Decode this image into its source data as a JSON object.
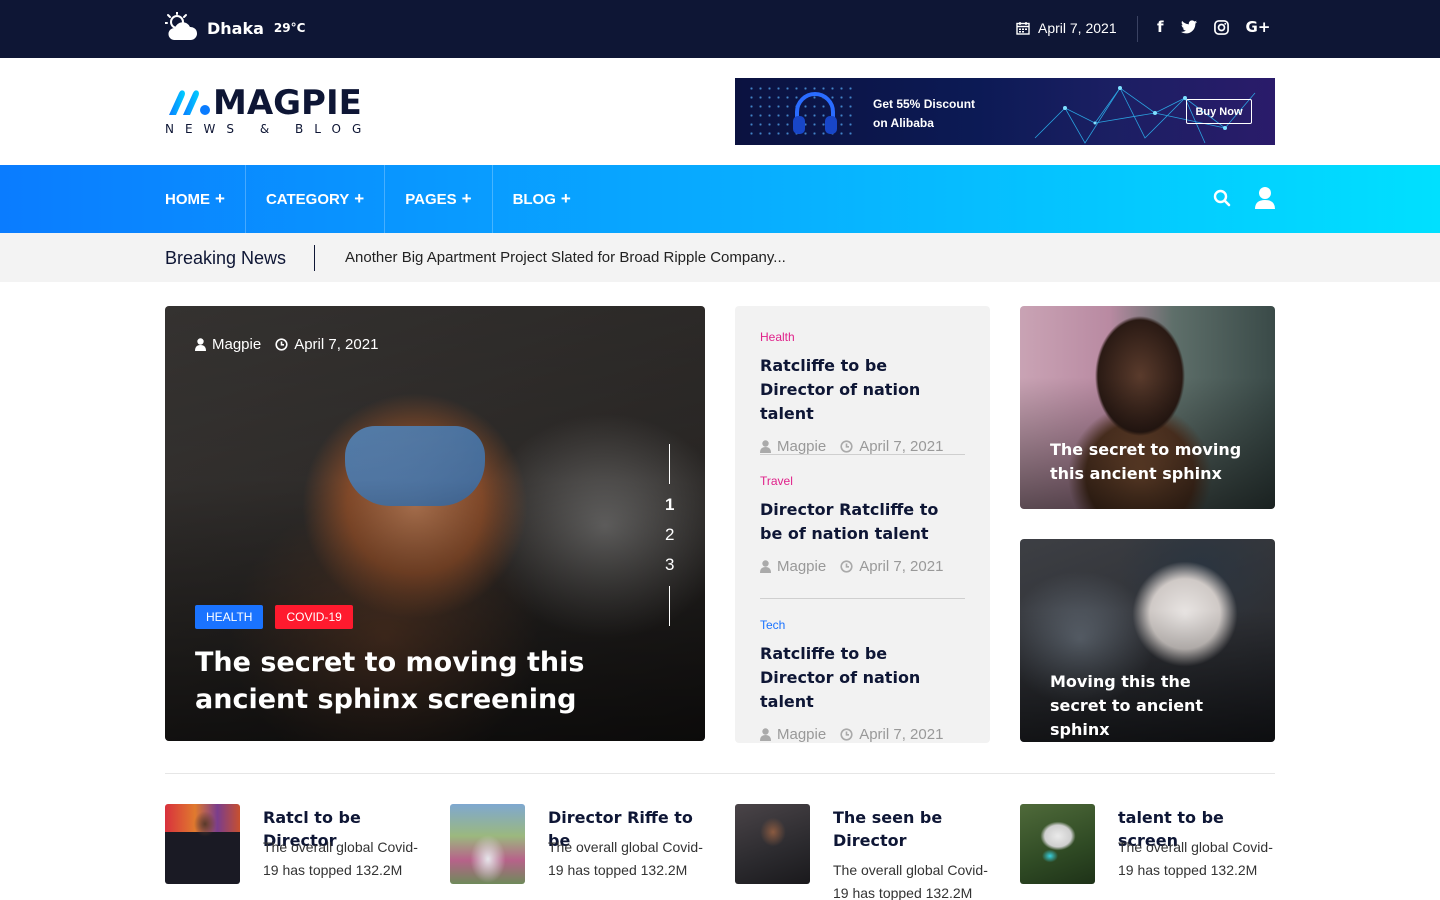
{
  "topbar": {
    "weather_city": "Dhaka",
    "weather_temp": "29°C",
    "weather_icon": "cloud-sun-icon",
    "date": "April 7, 2021",
    "date_icon": "calendar-icon",
    "socials": [
      {
        "name": "facebook-icon",
        "glyph": "f"
      },
      {
        "name": "twitter-icon",
        "glyph": "t"
      },
      {
        "name": "instagram-icon",
        "glyph": "ig"
      },
      {
        "name": "google-plus-icon",
        "glyph": "G+"
      }
    ]
  },
  "header": {
    "logo_title": "MAGPIE",
    "logo_subtitle": "NEWS & BLOG",
    "banner": {
      "line1": "Get 55% Discount",
      "line2": "on Alibaba",
      "button": "Buy Now"
    }
  },
  "nav": {
    "items": [
      {
        "label": "HOME"
      },
      {
        "label": "CATEGORY"
      },
      {
        "label": "PAGES"
      },
      {
        "label": "BLOG"
      }
    ],
    "plus": "+",
    "search_icon": "search-icon",
    "user_icon": "user-icon"
  },
  "breaking": {
    "label": "Breaking News",
    "text": "Another Big Apartment Project Slated for Broad Ripple Company..."
  },
  "hero": {
    "author": "Magpie",
    "date": "April 7, 2021",
    "slides": [
      "1",
      "2",
      "3"
    ],
    "tags": [
      "HEALTH",
      "COVID-19"
    ],
    "title": "The secret to moving this ancient sphinx screening"
  },
  "middle": [
    {
      "category": "Health",
      "category_color": "#e0218a",
      "title": "Ratcliffe to be Director of nation talent",
      "author": "Magpie",
      "date": "April 7, 2021"
    },
    {
      "category": "Travel",
      "category_color": "#e0218a",
      "title": "Director Ratcliffe to be of nation talent",
      "author": "Magpie",
      "date": "April 7, 2021"
    },
    {
      "category": "Tech",
      "category_color": "#1a73ff",
      "title": "Ratcliffe to be Director of nation talent",
      "author": "Magpie",
      "date": "April 7, 2021"
    }
  ],
  "right_cards": [
    {
      "title": "The secret to moving this ancient sphinx"
    },
    {
      "title": "Moving this the secret to ancient sphinx"
    }
  ],
  "bottom": [
    {
      "title": "Ratcl to be Director",
      "desc": "The overall global Covid-19 has topped 132.2M"
    },
    {
      "title": "Director Riffe to be",
      "desc": "The overall global Covid-19 has topped 132.2M"
    },
    {
      "title": "The seen be Director",
      "desc": "The overall global Covid-19 has topped 132.2M"
    },
    {
      "title": "talent to be screen",
      "desc": "The overall global Covid-19 has topped 132.2M"
    }
  ],
  "colors": {
    "navy": "#0e1635",
    "accent_blue": "#0a7cff",
    "accent_cyan": "#00e0ff",
    "tag_health": "#1a73ff",
    "tag_covid": "#ff1a2e"
  }
}
